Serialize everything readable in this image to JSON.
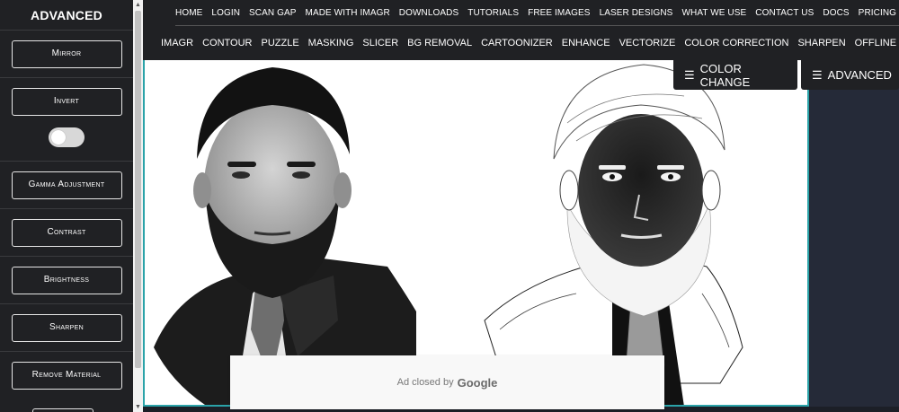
{
  "sidebar": {
    "title": "ADVANCED",
    "buttons": {
      "mirror": "Mirror",
      "invert": "Invert",
      "gamma": "Gamma Adjustment",
      "contrast": "Contrast",
      "brightness": "Brightness",
      "sharpen": "Sharpen",
      "remove_material": "Remove Material"
    },
    "invert_toggle": "off"
  },
  "nav": {
    "row1": [
      "HOME",
      "LOGIN",
      "SCAN GAP",
      "MADE WITH IMAGR",
      "DOWNLOADS",
      "TUTORIALS",
      "FREE IMAGES",
      "LASER DESIGNS",
      "WHAT WE USE",
      "CONTACT US",
      "DOCS",
      "PRICING"
    ],
    "row2": [
      "IMAGR",
      "CONTOUR",
      "PUZZLE",
      "MASKING",
      "SLICER",
      "BG REMOVAL",
      "CARTOONIZER",
      "ENHANCE",
      "VECTORIZE",
      "COLOR CORRECTION",
      "SHARPEN",
      "OFFLINE"
    ]
  },
  "overlay": {
    "color_change": "COLOR CHANGE",
    "advanced": "ADVANCED"
  },
  "ad": {
    "text": "Ad closed by",
    "brand": "Google"
  },
  "colors": {
    "accent_border": "#2ba3a9",
    "sidebar_bg": "#202124"
  },
  "icons": [
    "menu-icon",
    "scroll-up-icon",
    "scroll-down-icon"
  ]
}
